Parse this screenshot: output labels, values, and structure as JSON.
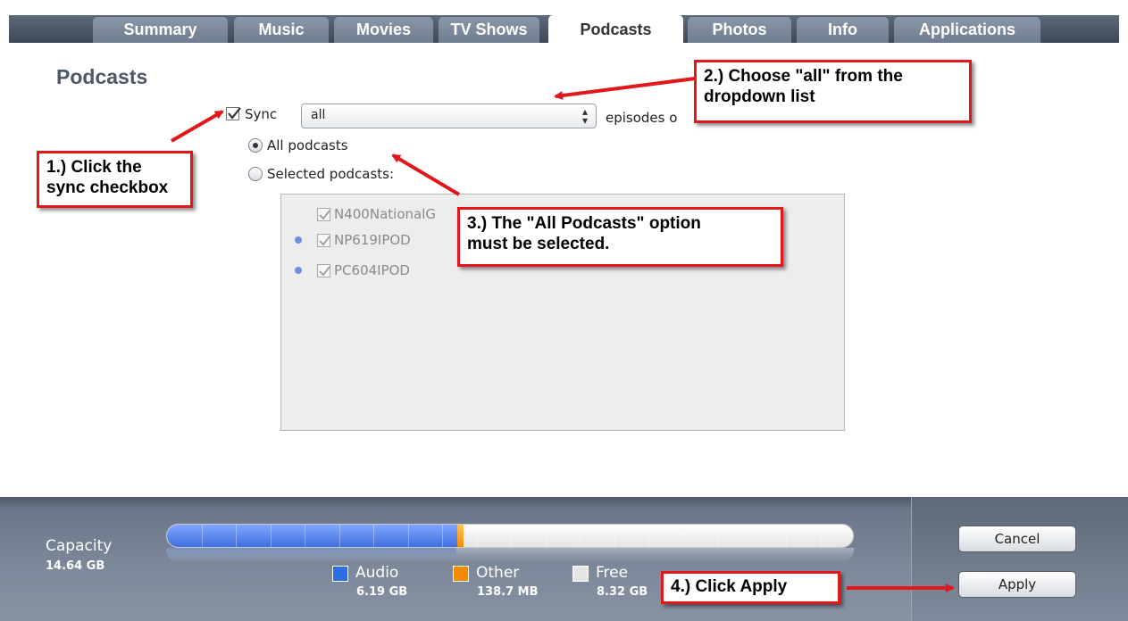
{
  "tabs": [
    {
      "label": "Summary"
    },
    {
      "label": "Music"
    },
    {
      "label": "Movies"
    },
    {
      "label": "TV Shows"
    },
    {
      "label": "Podcasts"
    },
    {
      "label": "Photos"
    },
    {
      "label": "Info"
    },
    {
      "label": "Applications"
    }
  ],
  "active_tab": "Podcasts",
  "section": {
    "title": "Podcasts"
  },
  "sync": {
    "checked": true,
    "label": "Sync",
    "select_value": "all",
    "episodes_text": "episodes o"
  },
  "options": {
    "all_podcasts": {
      "label": "All podcasts",
      "selected": true
    },
    "selected_podcasts": {
      "label": "Selected podcasts:",
      "selected": false
    }
  },
  "podcast_list": [
    {
      "name": "N400NationalG",
      "checked": true,
      "new": false
    },
    {
      "name": "NP619IPOD",
      "checked": true,
      "new": true
    },
    {
      "name": "PC604IPOD",
      "checked": true,
      "new": true
    }
  ],
  "capacity": {
    "label": "Capacity",
    "total": "14.64 GB",
    "audio_fraction": 0.423,
    "other_fraction": 0.0093,
    "legend": [
      {
        "name": "Audio",
        "value": "6.19 GB",
        "color": "#2f6ee0"
      },
      {
        "name": "Other",
        "value": "138.7 MB",
        "color": "#f28a00"
      },
      {
        "name": "Free",
        "value": "8.32 GB",
        "color": "#e6e6e6"
      }
    ]
  },
  "buttons": {
    "cancel": "Cancel",
    "apply": "Apply"
  },
  "callouts": {
    "step1": [
      "1.) Click the",
      "sync checkbox"
    ],
    "step2": [
      "2.) Choose \"all\" from the",
      "dropdown list"
    ],
    "step3": [
      "3.) The \"All Podcasts\" option",
      "must be selected."
    ],
    "step4": [
      "4.) Click Apply"
    ]
  },
  "colors": {
    "annotation_red": "#e0171b",
    "tab_active": "#ffffff",
    "tab_inactive": "#7d8a9c"
  }
}
